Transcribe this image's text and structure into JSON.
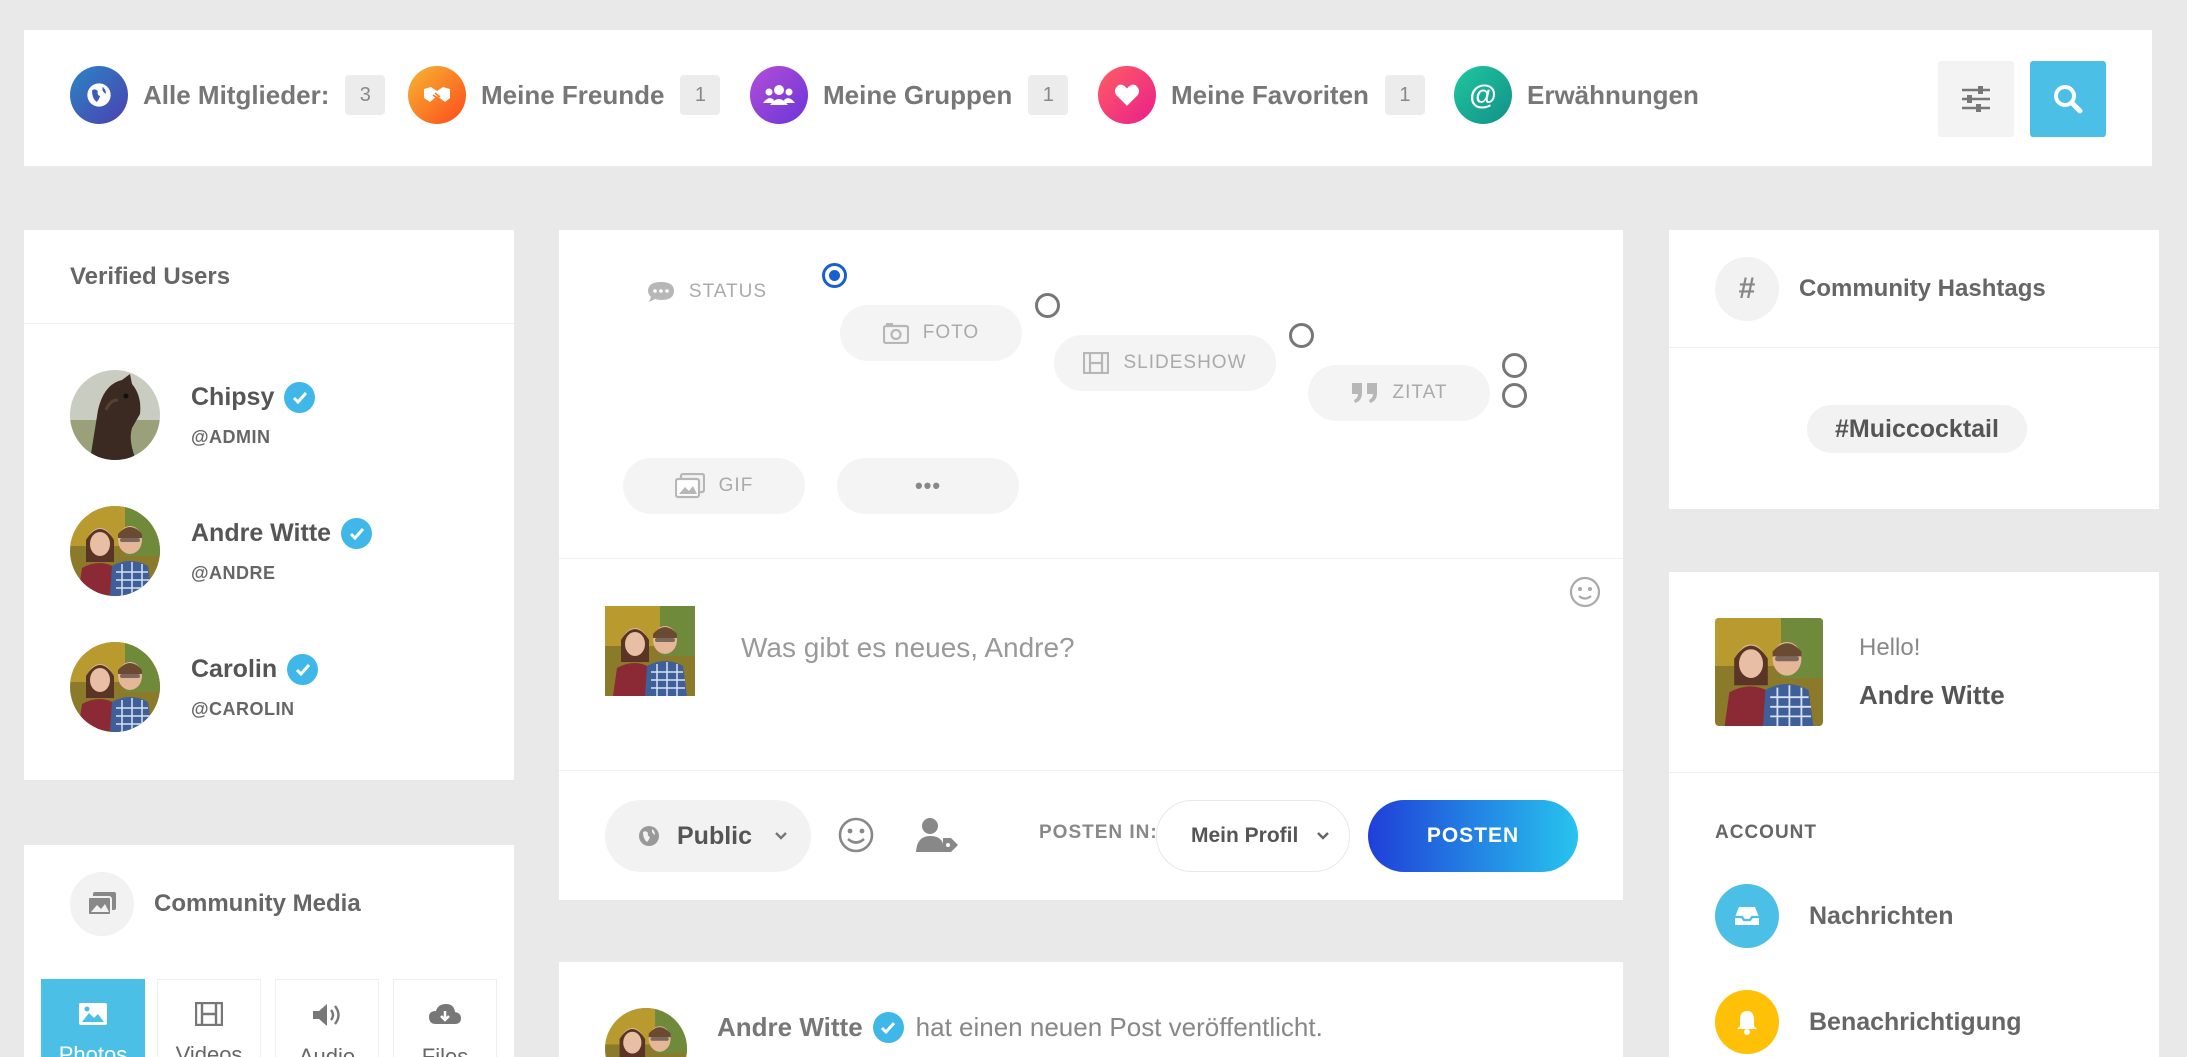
{
  "topnav": {
    "items": [
      {
        "label": "Alle Mitglieder:",
        "count": "3"
      },
      {
        "label": "Meine Freunde",
        "count": "1"
      },
      {
        "label": "Meine Gruppen",
        "count": "1"
      },
      {
        "label": "Meine Favoriten",
        "count": "1"
      },
      {
        "label": "Erwähnungen"
      }
    ]
  },
  "verified": {
    "title": "Verified Users",
    "users": [
      {
        "name": "Chipsy",
        "handle": "@ADMIN"
      },
      {
        "name": "Andre Witte",
        "handle": "@ANDRE"
      },
      {
        "name": "Carolin",
        "handle": "@CAROLIN"
      }
    ]
  },
  "media": {
    "title": "Community Media",
    "tabs": [
      "Photos",
      "Videos",
      "Audio",
      "Files"
    ]
  },
  "composer": {
    "types": [
      "STATUS",
      "FOTO",
      "SLIDESHOW",
      "ZITAT",
      "GIF"
    ],
    "more": "•••",
    "placeholder": "Was gibt es neues, Andre?",
    "privacy": "Public",
    "post_in_label": "POSTEN IN:",
    "post_in_value": "Mein Profil",
    "submit": "POSTEN"
  },
  "feed": {
    "author": "Andre Witte",
    "action": "hat einen neuen Post veröffentlicht."
  },
  "hashtags": {
    "title": "Community Hashtags",
    "tags": [
      "#Muiccocktail"
    ]
  },
  "account": {
    "greeting": "Hello!",
    "name": "Andre Witte",
    "section": "ACCOUNT",
    "items": [
      "Nachrichten",
      "Benachrichtigung"
    ]
  },
  "colors": {
    "accent": "#4cbfe6",
    "verified": "#3fb7e8",
    "submit_from": "#1f3fd8",
    "submit_to": "#27c4ee"
  }
}
